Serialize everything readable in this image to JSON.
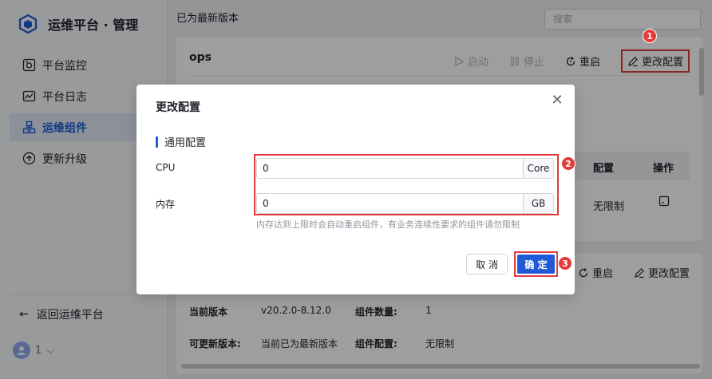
{
  "app": {
    "title": "运维平台 · 管理"
  },
  "nav": [
    {
      "label": "平台监控",
      "icon": "monitor-icon",
      "active": false
    },
    {
      "label": "平台日志",
      "icon": "log-chart-icon",
      "active": false
    },
    {
      "label": "运维组件",
      "icon": "components-icon",
      "active": true
    },
    {
      "label": "更新升级",
      "icon": "upgrade-icon",
      "active": false
    }
  ],
  "back": {
    "label": "返回运维平台"
  },
  "user": {
    "label": "1"
  },
  "header": {
    "version_note": "已为最新版本",
    "search_placeholder": "搜索"
  },
  "card": {
    "title": "ops",
    "actions": {
      "start": "启动",
      "stop": "停止",
      "restart": "重启",
      "edit": "更改配置"
    },
    "table": {
      "col_config": "配置",
      "col_action": "操作",
      "row_config": "无限制"
    }
  },
  "card2": {
    "actions": {
      "restart": "重启",
      "edit": "更改配置"
    },
    "current_version_label": "当前版本",
    "current_version": "v20.2.0-8.12.0",
    "component_count_label": "组件数量:",
    "component_count": "1",
    "available_version_label": "可更新版本:",
    "available_version": "当前已为最新版本",
    "component_config_label": "组件配置:",
    "component_config": "无限制"
  },
  "modal": {
    "title": "更改配置",
    "section": "通用配置",
    "cpu_label": "CPU",
    "cpu_value": "0",
    "cpu_unit": "Core",
    "mem_label": "内存",
    "mem_value": "0",
    "mem_unit": "GB",
    "hint": "内存达到上限时会自动重启组件，有业务连续性要求的组件请勿限制",
    "cancel": "取 消",
    "ok": "确 定"
  },
  "steps": [
    "1",
    "2",
    "3"
  ],
  "colors": {
    "accent": "#1f5bd6",
    "highlight": "#e33a3a"
  }
}
